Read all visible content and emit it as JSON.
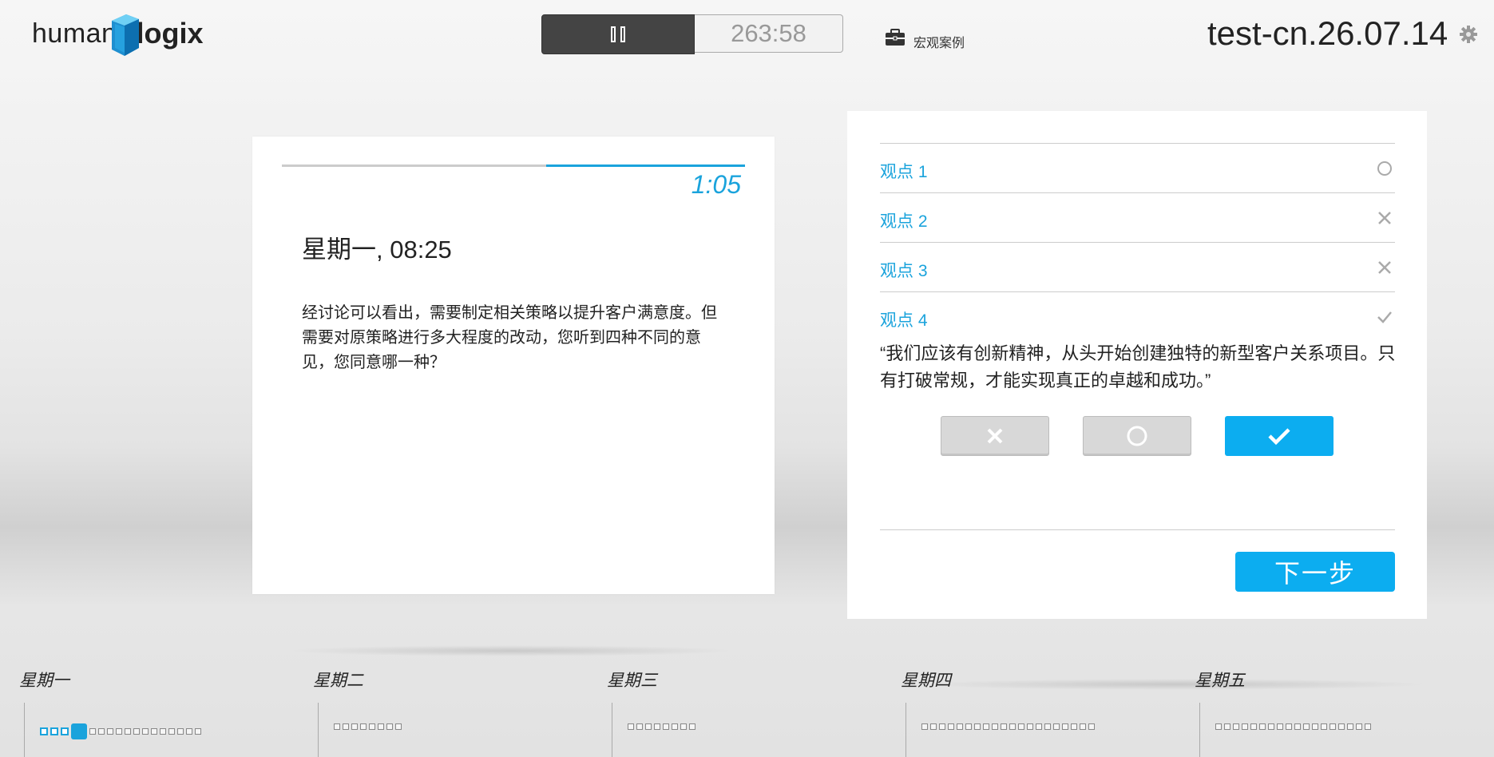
{
  "header": {
    "logo_part1": "human",
    "logo_part2": "logix",
    "timer": "263:58",
    "case_label": "宏观案例",
    "session_id": "test-cn.26.07.14"
  },
  "message": {
    "progress_fraction": 0.43,
    "countdown": "1:05",
    "title": "星期一, 08:25",
    "body": "经讨论可以看出，需要制定相关策略以提升客户满意度。但需要对原策略进行多大程度的改动，您听到四种不同的意见，您同意哪一种？"
  },
  "options": [
    {
      "label": "观点 1",
      "status": "neutral"
    },
    {
      "label": "观点 2",
      "status": "reject"
    },
    {
      "label": "观点 3",
      "status": "reject"
    },
    {
      "label": "观点 4",
      "status": "accept"
    }
  ],
  "selected_quote": "“我们应该有创新精神，从头开始创建独特的新型客户关系项目。只有打破常规，才能实现真正的卓越和成功。”",
  "rating_buttons": [
    "reject",
    "neutral",
    "accept"
  ],
  "selected_rating": "accept",
  "next_button": "下一步",
  "days": [
    {
      "label": "星期一",
      "count": 17,
      "done": 3,
      "current": 3
    },
    {
      "label": "星期二",
      "count": 8,
      "done": 0,
      "current": -1
    },
    {
      "label": "星期三",
      "count": 8,
      "done": 0,
      "current": -1
    },
    {
      "label": "星期四",
      "count": 20,
      "done": 0,
      "current": -1
    },
    {
      "label": "星期五",
      "count": 18,
      "done": 0,
      "current": -1
    }
  ],
  "colors": {
    "accent": "#1aa3dc",
    "button_blue": "#0cadf0",
    "dark": "#444444"
  }
}
